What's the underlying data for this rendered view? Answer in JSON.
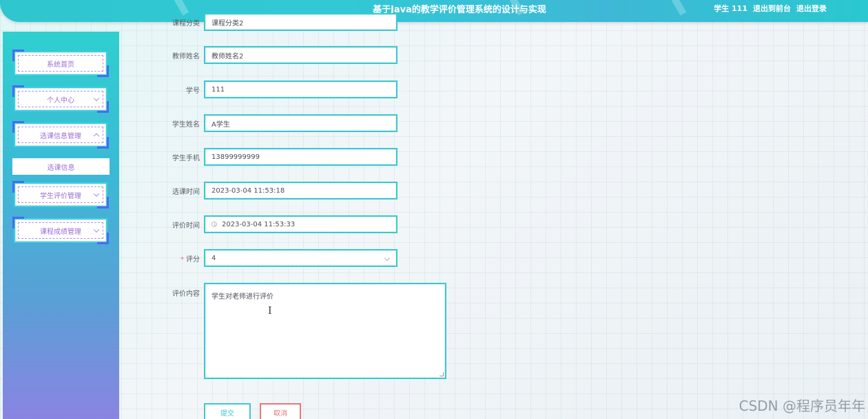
{
  "header": {
    "title": "基于Java的教学评价管理系统的设计与实现",
    "user": "学生 111",
    "back_to_front": "退出到前台",
    "logout": "退出登录"
  },
  "sidebar": {
    "items": [
      {
        "label": "系统首页"
      },
      {
        "label": "个人中心"
      },
      {
        "label": "选课信息管理"
      },
      {
        "label": "学生评价管理"
      },
      {
        "label": "课程成绩管理"
      }
    ],
    "submenu_label": "选课信息"
  },
  "form": {
    "course_category": {
      "label": "课程分类",
      "value": "课程分类2"
    },
    "teacher_name": {
      "label": "教师姓名",
      "value": "教师姓名2"
    },
    "student_id": {
      "label": "学号",
      "value": "111"
    },
    "student_name": {
      "label": "学生姓名",
      "value": "A学生"
    },
    "student_phone": {
      "label": "学生手机",
      "value": "13899999999"
    },
    "select_time": {
      "label": "选课时间",
      "value": "2023-03-04 11:53:18"
    },
    "eval_time": {
      "label": "评价时间",
      "value": "2023-03-04 11:53:33"
    },
    "score": {
      "label": "评分",
      "required_mark": "*",
      "value": "4"
    },
    "content": {
      "label": "评价内容",
      "value": "学生对老师进行评价"
    }
  },
  "buttons": {
    "submit": "提交",
    "cancel": "取消"
  },
  "watermark": "CSDN @程序员年年"
}
